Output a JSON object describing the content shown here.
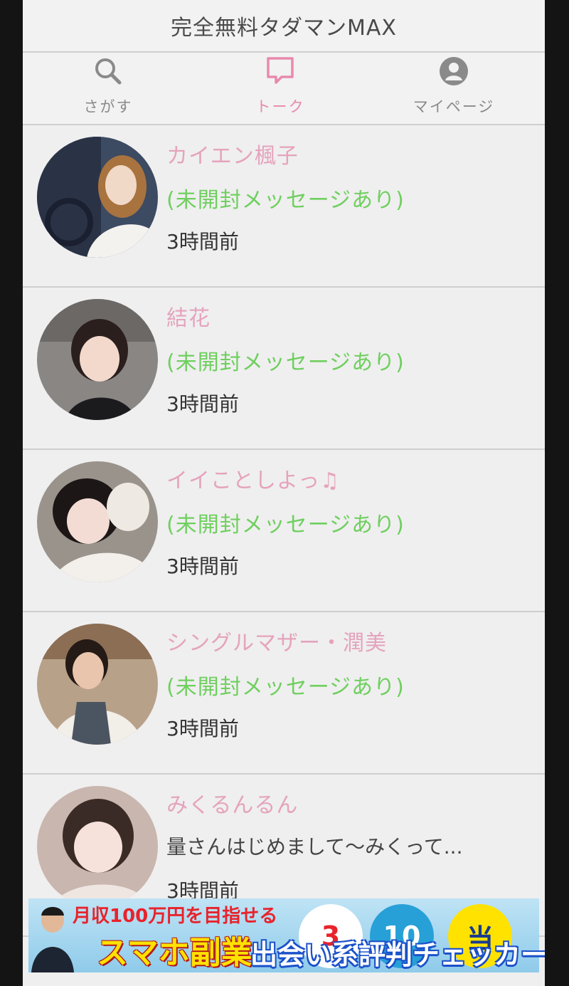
{
  "header": {
    "title": "完全無料タダマンMAX"
  },
  "tabs": [
    {
      "label": "さがす",
      "icon": "search-icon"
    },
    {
      "label": "トーク",
      "icon": "chat-bubble-icon"
    },
    {
      "label": "マイページ",
      "icon": "user-circle-icon"
    }
  ],
  "active_tab": "トーク",
  "accent_color": "#e889ad",
  "unread_color": "#6fcf5f",
  "conversations": [
    {
      "name": "カイエン楓子",
      "message": "(未開封メッセージあり)",
      "time": "3時間前",
      "unread": true
    },
    {
      "name": "結花",
      "message": "(未開封メッセージあり)",
      "time": "3時間前",
      "unread": true
    },
    {
      "name": "イイことしよっ♫",
      "message": "(未開封メッセージあり)",
      "time": "3時間前",
      "unread": true
    },
    {
      "name": "シングルマザー・潤美",
      "message": "(未開封メッセージあり)",
      "time": "3時間前",
      "unread": true
    },
    {
      "name": "みくるんるん",
      "message": "量さんはじめまして〜みくって...",
      "time": "3時間前",
      "unread": false
    }
  ],
  "banner": {
    "line1": "月収100万円を目指せる",
    "line2": "スマホ副業",
    "badge1": "3",
    "badge2": "10",
    "badge3": "当"
  },
  "watermark": "出会い系評判チェッカー"
}
